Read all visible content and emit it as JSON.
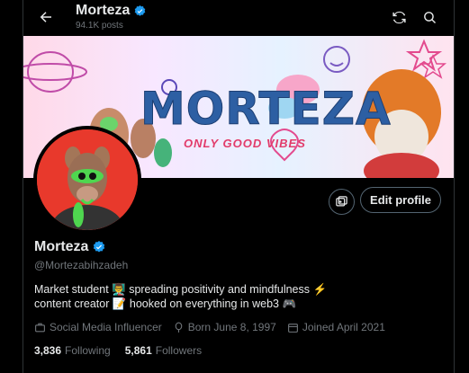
{
  "header": {
    "name": "Morteza",
    "posts": "94.1K posts"
  },
  "banner": {
    "title": "MORTEZA",
    "subtitle": "ONLY GOOD VIBES"
  },
  "actions": {
    "edit_profile": "Edit profile"
  },
  "profile": {
    "name": "Morteza",
    "handle": "@Mortezabihzadeh",
    "bio_line1": "Market student 👨‍🏫 spreading positivity and mindfulness ⚡",
    "bio_line2": "content creator 📝 hooked on everything in web3 🎮",
    "category": "Social Media Influencer",
    "born": "Born June 8, 1997",
    "joined": "Joined April 2021"
  },
  "stats": {
    "following_count": "3,836",
    "following_label": "Following",
    "followers_count": "5,861",
    "followers_label": "Followers"
  },
  "colors": {
    "verified": "#1d9bf0",
    "muted": "#71767b",
    "text": "#e7e9ea",
    "background": "#000000"
  }
}
